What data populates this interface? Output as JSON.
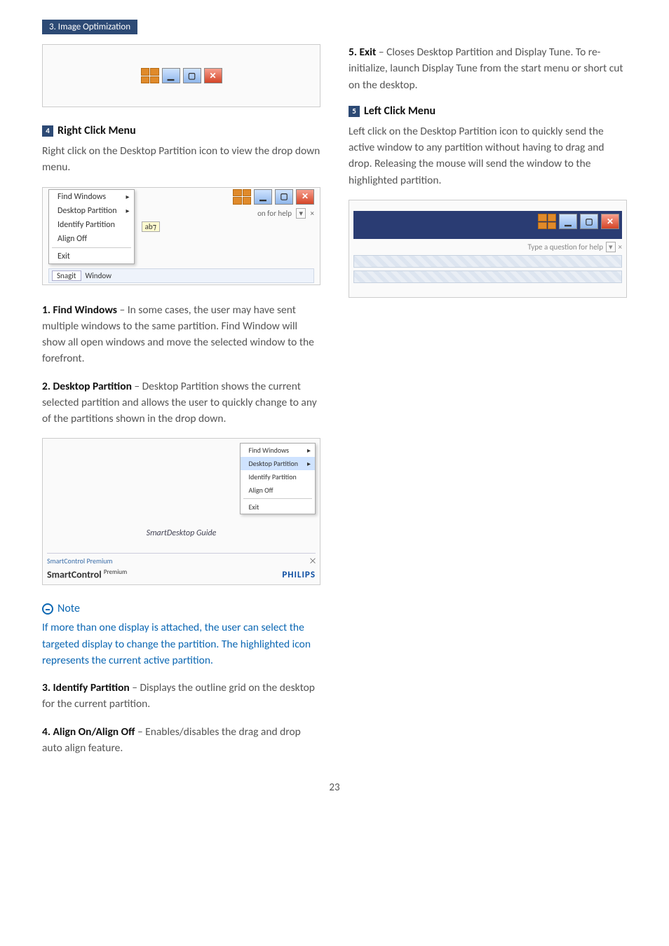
{
  "chapter_tab": "3. Image Optimization",
  "section4": {
    "num": "4",
    "title": "Right Click Menu"
  },
  "rc_intro": "Right click on the Desktop Partition icon to view the drop down menu.",
  "ctx_menu": {
    "find": "Find Windows",
    "dp": "Desktop Partition",
    "identify": "Identify Partition",
    "align": "Align Off",
    "exit": "Exit",
    "help_hint": "on for help",
    "snagit": "Snagit",
    "window": "Window"
  },
  "item1_lead": "1. Find Windows",
  "item1_body": " – In some cases, the user may   have sent multiple windows to the same partition.  Find Window will show all open windows and move the selected window to the forefront.",
  "item2_lead": "2. Desktop Partition",
  "item2_body": " – Desktop Partition shows the current selected partition and allows the user to quickly change to any of the partitions shown in the drop down.",
  "dp_fig": {
    "title": "SmartDesktop Guide",
    "menu_find": "Find Windows",
    "menu_dp": "Desktop Partition",
    "menu_identify": "Identify Partition",
    "menu_align": "Align Off",
    "menu_exit": "Exit",
    "footer_l": "SmartControl Premium",
    "brand": "PHILIPS",
    "smartcontrol": "SmartControl",
    "premium": "Premium"
  },
  "note_title": "Note",
  "note_body": "If more than one display is attached, the user can select the targeted display to change the partition.  The highlighted icon represents the current active partition.",
  "item3_lead": "3. Identify Partition",
  "item3_body": " – Displays the outline grid on the desktop for the current partition.",
  "item4_lead": "4. Align On/Align Off",
  "item4_body": " – Enables/disables the drag and drop auto align feature.",
  "item5_lead": "5. Exit",
  "item5_body": " – Closes Desktop Partition and  Display Tune.  To re-initialize, launch   Display Tune from the start menu or short cut   on the desktop.",
  "section5": {
    "num": "5",
    "title": "Left Click Menu"
  },
  "lc_intro": "Left click on the Desktop Partition icon to quickly send the active window to any partition without having to drag and drop. Releasing the mouse will send the window to the highlighted partition.",
  "lc_fig": {
    "hint": "Type a question for help"
  },
  "page_number": "23"
}
